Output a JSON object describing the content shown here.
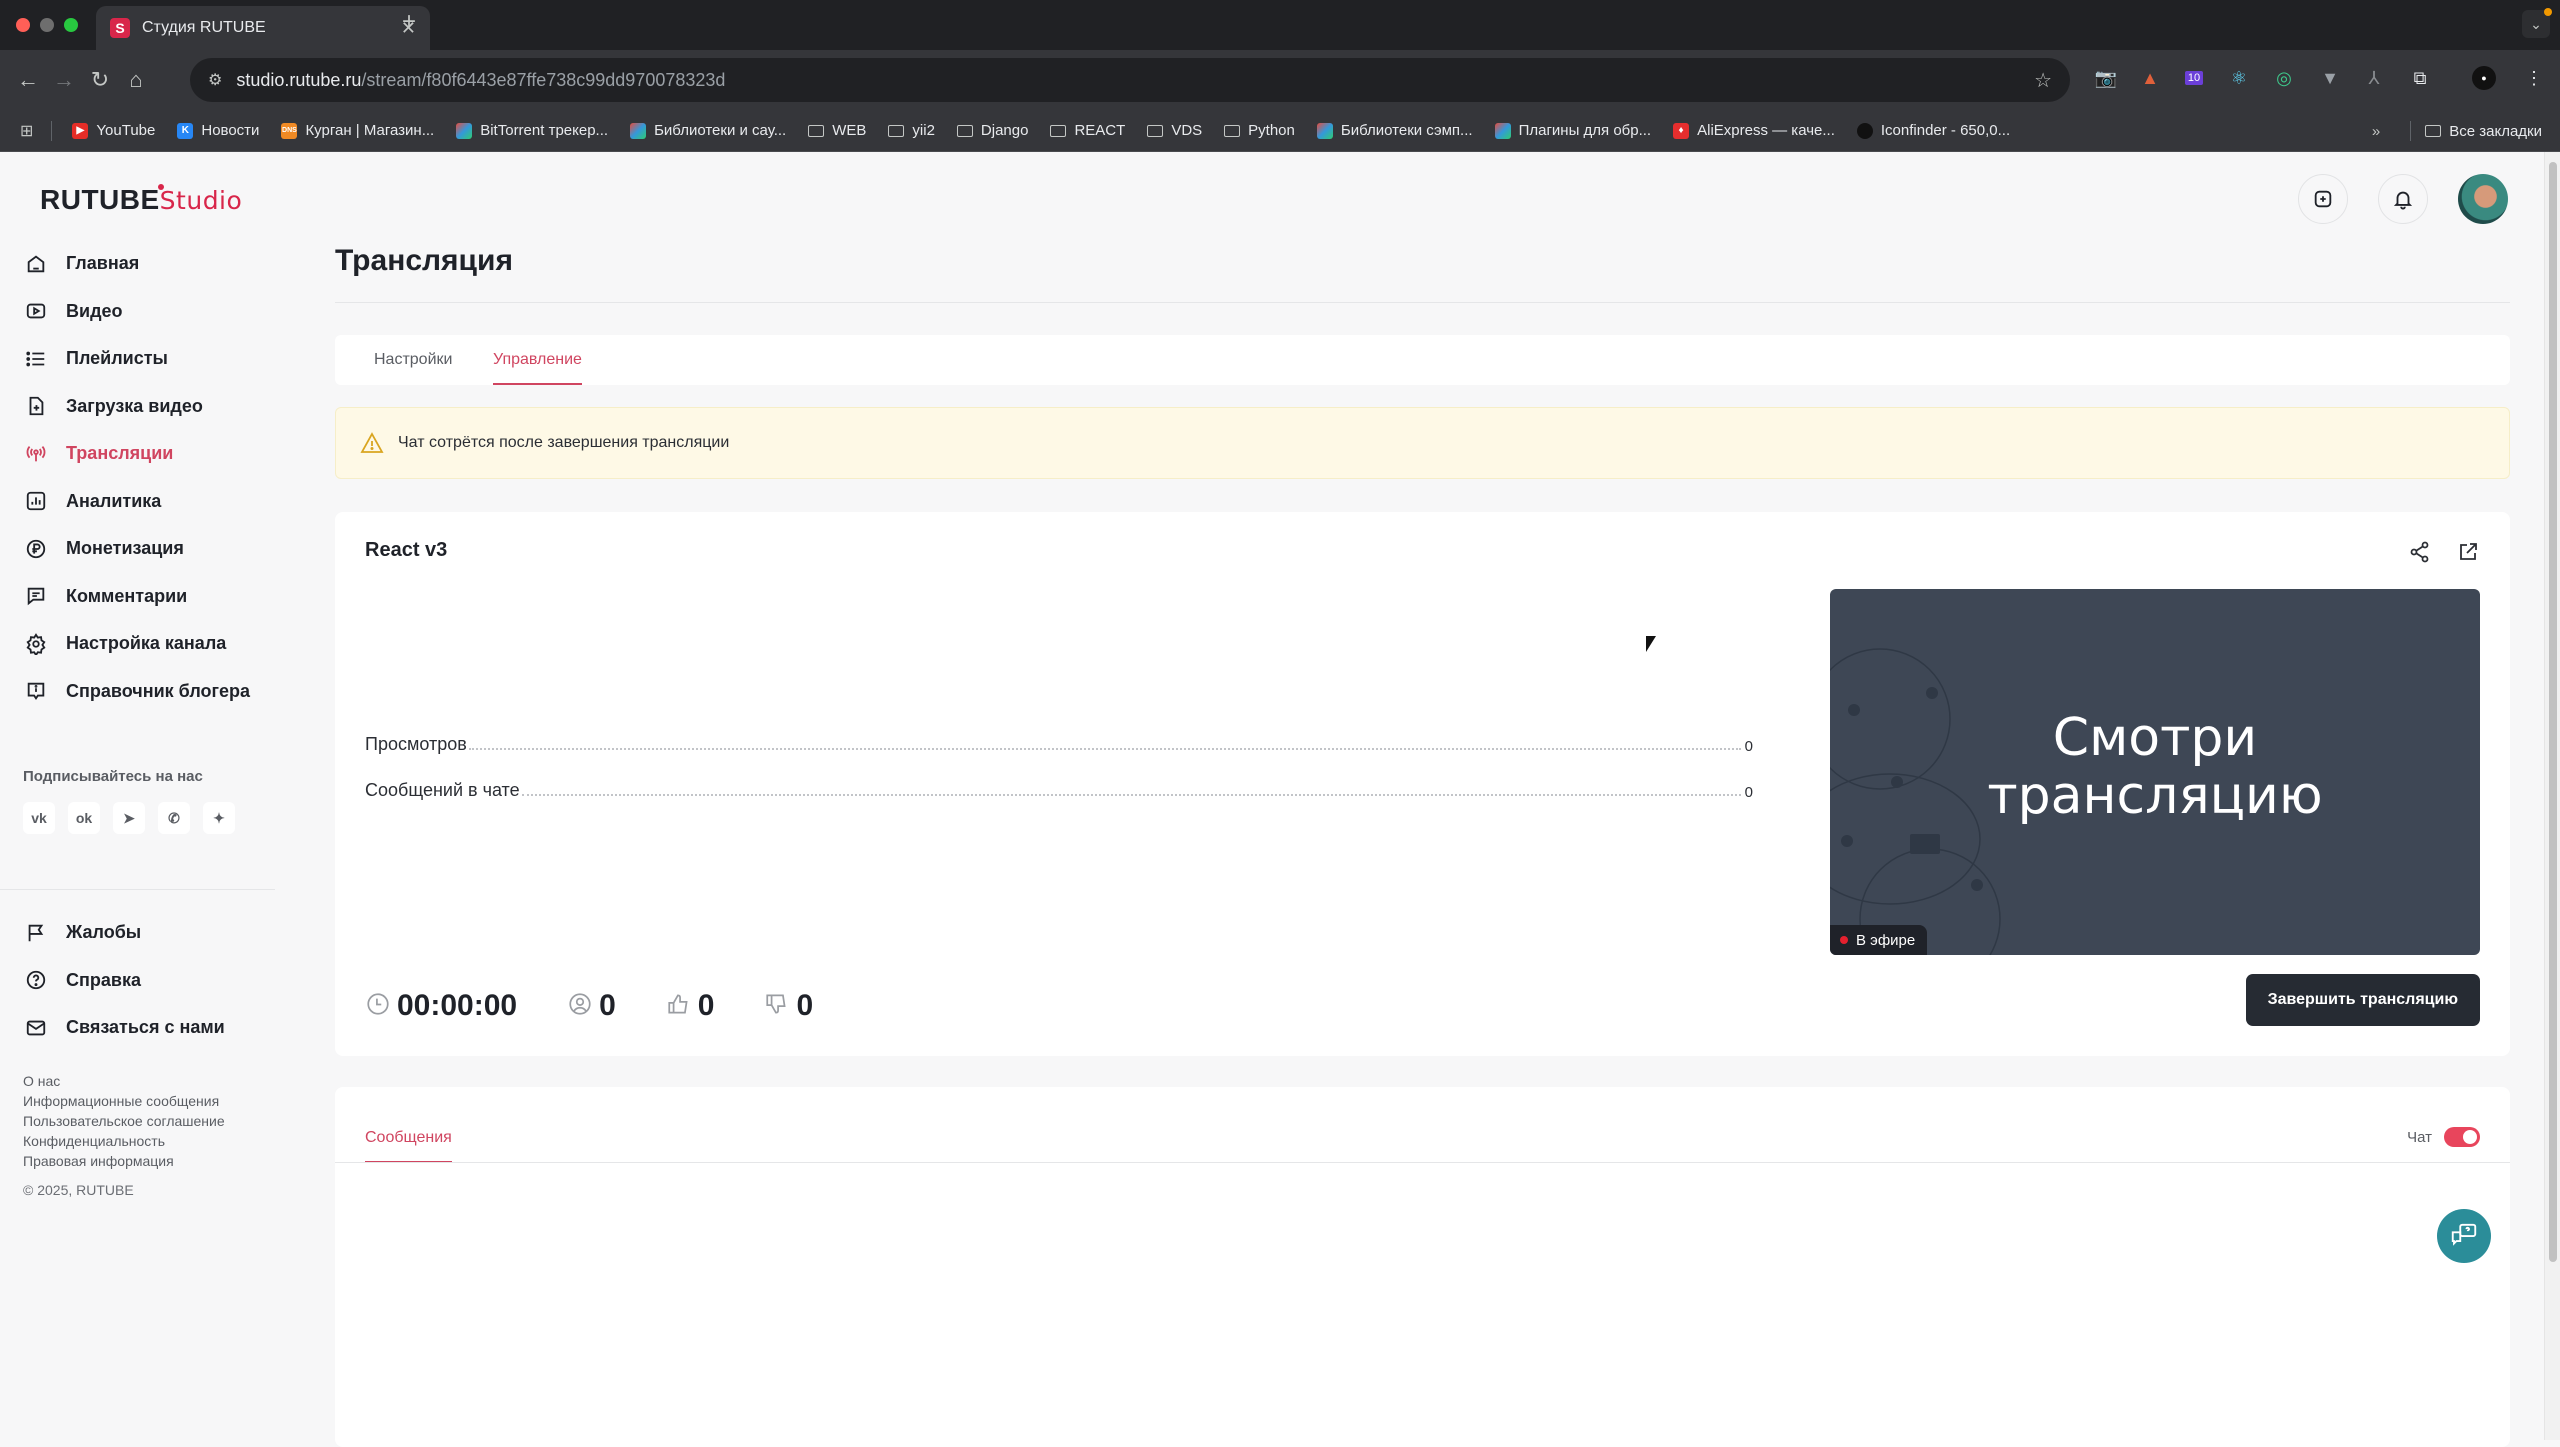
{
  "browser": {
    "tab_title": "Студия RUTUBE",
    "tab_favicon": "S",
    "url_host": "studio.rutube.ru",
    "url_path": "/stream/f80f6443e87ffe738c99dd970078323d",
    "extension_badge": "10",
    "bookmarks": [
      {
        "label": "YouTube",
        "icon": "youtube-icon",
        "color": "#e52d27"
      },
      {
        "label": "Новости",
        "icon": "vk-icon",
        "color": "#2787f5"
      },
      {
        "label": "Курган | Магазин...",
        "icon": "dns-icon",
        "color": "#f08a24"
      },
      {
        "label": "BitTorrent трекер...",
        "icon": "rainbow-icon",
        "color": "#9b59b6"
      },
      {
        "label": "Библиотеки и сау...",
        "icon": "rainbow-icon",
        "color": "#9b59b6"
      },
      {
        "label": "WEB",
        "icon": "folder-icon"
      },
      {
        "label": "yii2",
        "icon": "folder-icon"
      },
      {
        "label": "Django",
        "icon": "folder-icon"
      },
      {
        "label": "REACT",
        "icon": "folder-icon"
      },
      {
        "label": "VDS",
        "icon": "folder-icon"
      },
      {
        "label": "Python",
        "icon": "folder-icon"
      },
      {
        "label": "Библиотеки сэмп...",
        "icon": "rainbow-icon",
        "color": "#9b59b6"
      },
      {
        "label": "Плагины для обр...",
        "icon": "rainbow-icon",
        "color": "#9b59b6"
      },
      {
        "label": "AliExpress — каче...",
        "icon": "aliexpress-icon",
        "color": "#e62e2e"
      },
      {
        "label": "Iconfinder - 650,0...",
        "icon": "iconfinder-icon",
        "color": "#222"
      }
    ],
    "overflow_label": "»",
    "all_bookmarks_label": "Все закладки"
  },
  "brand": {
    "name": "RUTUBE",
    "suffix": "Studio",
    "accent": "#d8264a"
  },
  "sidebar": {
    "items": [
      {
        "label": "Главная",
        "icon": "home-icon",
        "active": false
      },
      {
        "label": "Видео",
        "icon": "video-icon",
        "active": false
      },
      {
        "label": "Плейлисты",
        "icon": "playlist-icon",
        "active": false
      },
      {
        "label": "Загрузка видео",
        "icon": "upload-icon",
        "active": false
      },
      {
        "label": "Трансляции",
        "icon": "broadcast-icon",
        "active": true
      },
      {
        "label": "Аналитика",
        "icon": "analytics-icon",
        "active": false
      },
      {
        "label": "Монетизация",
        "icon": "ruble-icon",
        "active": false
      },
      {
        "label": "Комментарии",
        "icon": "comment-icon",
        "active": false
      },
      {
        "label": "Настройка канала",
        "icon": "gear-icon",
        "active": false
      },
      {
        "label": "Справочник блогера",
        "icon": "info-icon",
        "active": false
      }
    ],
    "subscribe_label": "Подписывайтесь на нас",
    "socials": [
      "vk-icon",
      "ok-icon",
      "telegram-icon",
      "viber-icon",
      "sparkle-icon"
    ],
    "secondary": [
      {
        "label": "Жалобы",
        "icon": "flag-icon"
      },
      {
        "label": "Справка",
        "icon": "help-icon"
      },
      {
        "label": "Связаться с нами",
        "icon": "mail-icon"
      }
    ],
    "footer_links": [
      "О нас",
      "Информационные сообщения",
      "Пользовательское соглашение",
      "Конфиденциальность",
      "Правовая информация"
    ],
    "copyright": "© 2025, RUTUBE"
  },
  "page": {
    "title": "Трансляция",
    "tabs": [
      {
        "label": "Настройки",
        "active": false
      },
      {
        "label": "Управление",
        "active": true
      }
    ],
    "warning": "Чат сотрётся после завершения трансляции"
  },
  "stream": {
    "title": "React v3",
    "stats": [
      {
        "label": "Просмотров",
        "value": "0"
      },
      {
        "label": "Сообщений в чате",
        "value": "0"
      }
    ],
    "preview_text_line1": "Смотри",
    "preview_text_line2": "трансляцию",
    "live_label": "В эфире",
    "duration": "00:00:00",
    "viewers": "0",
    "likes": "0",
    "dislikes": "0",
    "end_button": "Завершить трансляцию"
  },
  "messages": {
    "tab_label": "Сообщения",
    "chat_label": "Чат",
    "chat_enabled": true
  }
}
